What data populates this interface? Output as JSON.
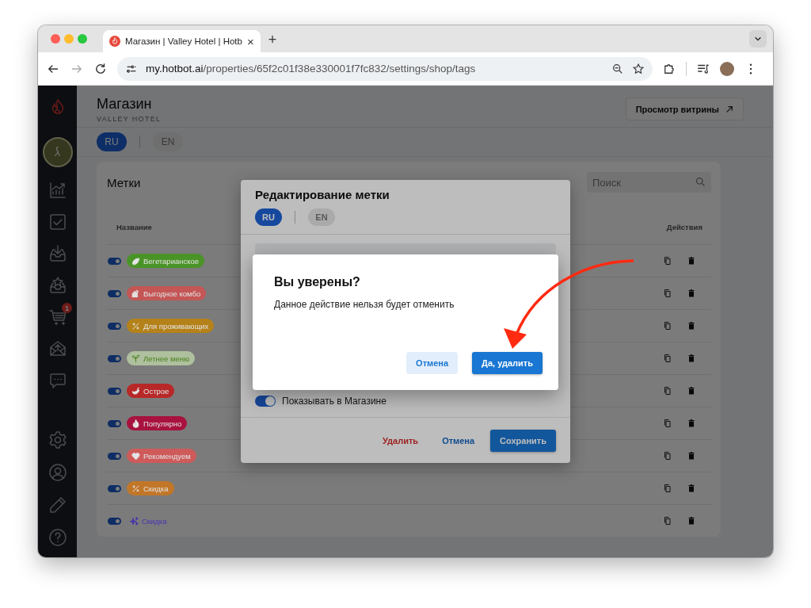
{
  "browser": {
    "tab": {
      "title": "Магазин | Valley Hotel | Hotb",
      "close": "×"
    },
    "new_tab": "+",
    "url": {
      "host": "my.hotbot.ai",
      "path": "/properties/65f2c01f38e330001f7fc832/settings/shop/tags"
    }
  },
  "sidebar": {
    "cart_badge": "1"
  },
  "page": {
    "title": "Магазин",
    "subtitle": "VALLEY HOTEL",
    "storefront_button": "Просмотр витрины",
    "languages": [
      {
        "label": "RU",
        "selected": true
      },
      {
        "label": "EN",
        "selected": false
      }
    ]
  },
  "tags_card": {
    "title": "Метки",
    "search": {
      "placeholder": "Поиск"
    },
    "columns": [
      "Название",
      "Действия"
    ],
    "rows": [
      {
        "label": "Вегетарианское",
        "on": true,
        "kind": "pill",
        "color": "#4a9427"
      },
      {
        "label": "Выгодное комбо",
        "on": true,
        "kind": "pill",
        "color": "#c45656"
      },
      {
        "label": "Для проживающих",
        "on": true,
        "kind": "pill",
        "color": "#b5821a"
      },
      {
        "label": "Летнее меню",
        "on": true,
        "kind": "soft",
        "color": "#4b7f1c"
      },
      {
        "label": "Острое",
        "on": true,
        "kind": "pill",
        "color": "#b82828"
      },
      {
        "label": "Популярно",
        "on": true,
        "kind": "pill",
        "color": "#a8123f"
      },
      {
        "label": "Рекомендуем",
        "on": true,
        "kind": "pill",
        "color": "#cf5a5a"
      },
      {
        "label": "Скидка",
        "on": true,
        "kind": "pill",
        "color": "#c27628"
      },
      {
        "label": "Скидка",
        "on": true,
        "kind": "plain",
        "color": "#4a32b0"
      }
    ]
  },
  "edit_dialog": {
    "title": "Редактирование метки",
    "languages": [
      {
        "label": "RU",
        "selected": true
      },
      {
        "label": "EN",
        "selected": false
      }
    ],
    "show_in_shop": {
      "label": "Показывать в Магазине",
      "on": true
    },
    "buttons": [
      {
        "label": "Удалить",
        "kind": "danger"
      },
      {
        "label": "Отмена",
        "kind": "text"
      },
      {
        "label": "Сохранить",
        "kind": "primary"
      }
    ]
  },
  "confirm_dialog": {
    "title": "Вы уверены?",
    "message": "Данное действие нельзя будет отменить",
    "buttons": [
      {
        "label": "Отмена",
        "kind": "secondary"
      },
      {
        "label": "Да, удалить",
        "kind": "primary"
      }
    ]
  }
}
